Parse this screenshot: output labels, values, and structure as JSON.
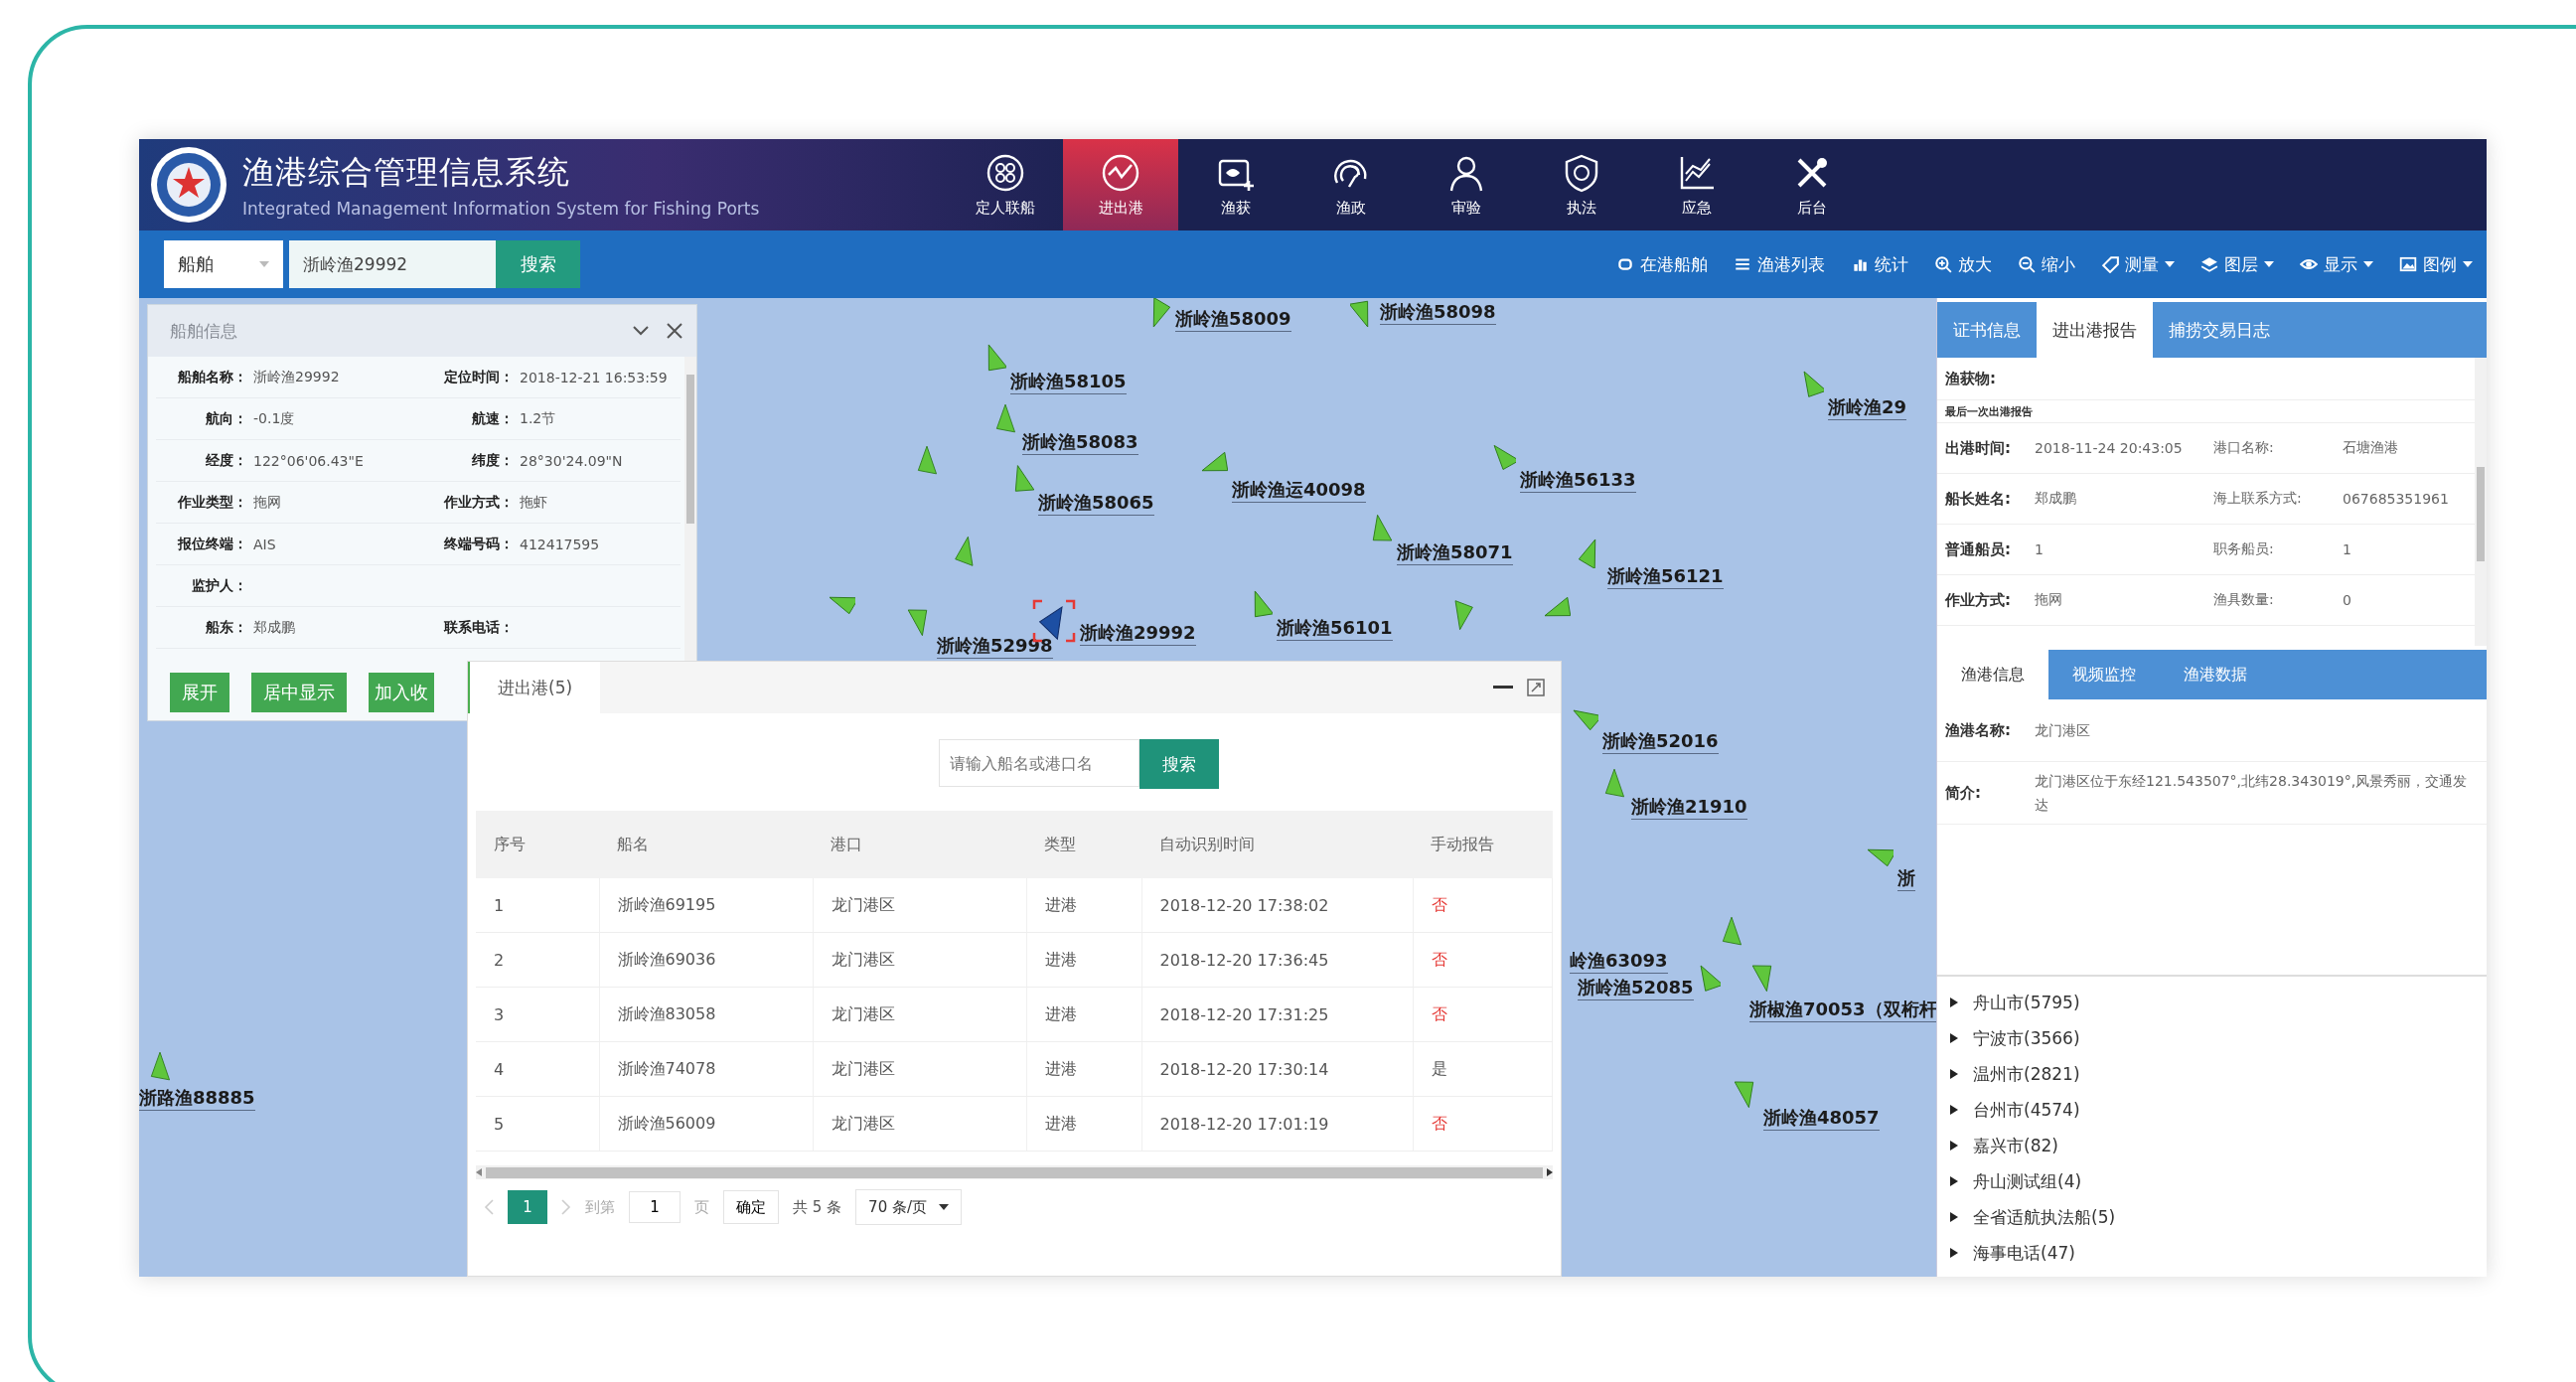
{
  "header": {
    "title": "渔港综合管理信息系统",
    "subtitle": "Integrated Management Information System for Fishing Ports",
    "nav": [
      {
        "label": "定人联船",
        "selected": false
      },
      {
        "label": "进出港",
        "selected": true
      },
      {
        "label": "渔获",
        "selected": false
      },
      {
        "label": "渔政",
        "selected": false
      },
      {
        "label": "审验",
        "selected": false
      },
      {
        "label": "执法",
        "selected": false
      },
      {
        "label": "应急",
        "selected": false
      },
      {
        "label": "后台",
        "selected": false
      }
    ]
  },
  "search": {
    "category": "船舶",
    "value": "浙岭渔29992",
    "button": "搜索"
  },
  "toolbar": [
    {
      "label": "在港船舶",
      "dropdown": false
    },
    {
      "label": "渔港列表",
      "dropdown": false
    },
    {
      "label": "统计",
      "dropdown": false
    },
    {
      "label": "放大",
      "dropdown": false
    },
    {
      "label": "缩小",
      "dropdown": false
    },
    {
      "label": "测量",
      "dropdown": true
    },
    {
      "label": "图层",
      "dropdown": true
    },
    {
      "label": "显示",
      "dropdown": true
    },
    {
      "label": "图例",
      "dropdown": true
    }
  ],
  "map": {
    "ships": [
      {
        "name": "浙岭渔58009",
        "selected": false
      },
      {
        "name": "浙岭渔58098",
        "selected": false
      },
      {
        "name": "浙岭渔58105",
        "selected": false
      },
      {
        "name": "浙岭渔58083",
        "selected": false
      },
      {
        "name": "浙岭渔58065",
        "selected": false
      },
      {
        "name": "浙岭渔运40098",
        "selected": false
      },
      {
        "name": "浙岭渔56133",
        "selected": false
      },
      {
        "name": "浙岭渔58071",
        "selected": false
      },
      {
        "name": "浙岭渔56121",
        "selected": false
      },
      {
        "name": "浙岭渔52998",
        "selected": false
      },
      {
        "name": "浙岭渔29992",
        "selected": true
      },
      {
        "name": "浙岭渔56101",
        "selected": false
      },
      {
        "name": "浙岭渔29",
        "selected": false
      },
      {
        "name": "浙岭渔52016",
        "selected": false
      },
      {
        "name": "浙岭渔21910",
        "selected": false
      },
      {
        "name": "浙",
        "selected": false
      },
      {
        "name": "岭渔63093",
        "selected": false
      },
      {
        "name": "浙岭渔52085",
        "selected": false
      },
      {
        "name": "浙椒渔70053（双桁杆",
        "selected": false
      },
      {
        "name": "浙路渔88885",
        "selected": false
      },
      {
        "name": "浙岭渔48057",
        "selected": false
      }
    ]
  },
  "ship_info": {
    "title": "船舶信息",
    "rows": [
      [
        {
          "label": "船舶名称：",
          "value": "浙岭渔29992"
        },
        {
          "label": "定位时间：",
          "value": "2018-12-21 16:53:59"
        }
      ],
      [
        {
          "label": "航向：",
          "value": "-0.1度"
        },
        {
          "label": "航速：",
          "value": "1.2节"
        }
      ],
      [
        {
          "label": "经度：",
          "value": "122°06'06.43\"E"
        },
        {
          "label": "纬度：",
          "value": "28°30'24.09\"N"
        }
      ],
      [
        {
          "label": "作业类型：",
          "value": "拖网"
        },
        {
          "label": "作业方式：",
          "value": "拖虾"
        }
      ],
      [
        {
          "label": "报位终端：",
          "value": "AIS"
        },
        {
          "label": "终端号码：",
          "value": "412417595"
        }
      ],
      [
        {
          "label": "监护人："
        }
      ],
      [
        {
          "label": "船东：",
          "value": "郑成鹏"
        },
        {
          "label": "联系电话："
        }
      ]
    ],
    "buttons": [
      "展开",
      "居中显示",
      "加入收"
    ]
  },
  "dialog": {
    "tab": "进出港(5)",
    "search": {
      "placeholder": "请输入船名或港口名",
      "button": "搜索"
    },
    "columns": [
      "序号",
      "船名",
      "港口",
      "类型",
      "自动识别时间",
      "手动报告"
    ],
    "rows": [
      {
        "cells": [
          "1",
          "浙岭渔69195",
          "龙门港区",
          "进港",
          "2018-12-20 17:38:02",
          "否"
        ],
        "alert": true
      },
      {
        "cells": [
          "2",
          "浙岭渔69036",
          "龙门港区",
          "进港",
          "2018-12-20 17:36:45",
          "否"
        ],
        "alert": true
      },
      {
        "cells": [
          "3",
          "浙岭渔83058",
          "龙门港区",
          "进港",
          "2018-12-20 17:31:25",
          "否"
        ],
        "alert": true
      },
      {
        "cells": [
          "4",
          "浙岭渔74078",
          "龙门港区",
          "进港",
          "2018-12-20 17:30:14",
          "是"
        ],
        "alert": false
      },
      {
        "cells": [
          "5",
          "浙岭渔56009",
          "龙门港区",
          "进港",
          "2018-12-20 17:01:19",
          "否"
        ],
        "alert": true
      }
    ],
    "pagination": {
      "pages": [
        {
          "label": "1",
          "selected": true
        }
      ],
      "goto_label": "到第",
      "goto_value": "1",
      "page_unit": "页",
      "confirm": "确定",
      "total": "共 5 条",
      "page_size": "70 条/页"
    }
  },
  "right_panel": {
    "tabs": [
      {
        "label": "证书信息",
        "selected": false
      },
      {
        "label": "进出港报告",
        "selected": true
      },
      {
        "label": "捕捞交易日志",
        "selected": false
      }
    ],
    "catch_label": "渔获物:",
    "section_title": "最后一次出港报告",
    "rows": [
      [
        {
          "label": "出港时间:",
          "value": "2018-11-24 20:43:05"
        },
        {
          "label": "港口名称:",
          "value": "石塘渔港"
        }
      ],
      [
        {
          "label": "船长姓名:",
          "value": "郑成鹏"
        },
        {
          "label": "海上联系方式:",
          "value": "067685351961"
        }
      ],
      [
        {
          "label": "普通船员:",
          "value": "1"
        },
        {
          "label": "职务船员:",
          "value": "1"
        }
      ],
      [
        {
          "label": "作业方式:",
          "value": "拖网"
        },
        {
          "label": "渔具数量:",
          "value": "0"
        }
      ]
    ],
    "port_tabs": [
      {
        "label": "渔港信息",
        "selected": true
      },
      {
        "label": "视频监控",
        "selected": false
      },
      {
        "label": "渔港数据",
        "selected": false
      }
    ],
    "port_fields": [
      {
        "label": "渔港名称:",
        "value": "龙门港区"
      },
      {
        "label": "简介:",
        "value": "龙门港区位于东经121.543507°,北纬28.343019°,风景秀丽，交通发达"
      }
    ],
    "tree": [
      {
        "label": "舟山市(5795)",
        "expanded": false
      },
      {
        "label": "宁波市(3566)",
        "expanded": false
      },
      {
        "label": "温州市(2821)",
        "expanded": false
      },
      {
        "label": "台州市(4574)",
        "expanded": false
      },
      {
        "label": "嘉兴市(82)",
        "expanded": false
      },
      {
        "label": "舟山测试组(4)",
        "expanded": false
      },
      {
        "label": "全省适航执法船(5)",
        "expanded": false
      },
      {
        "label": "海事电话(47)",
        "expanded": false
      }
    ]
  }
}
